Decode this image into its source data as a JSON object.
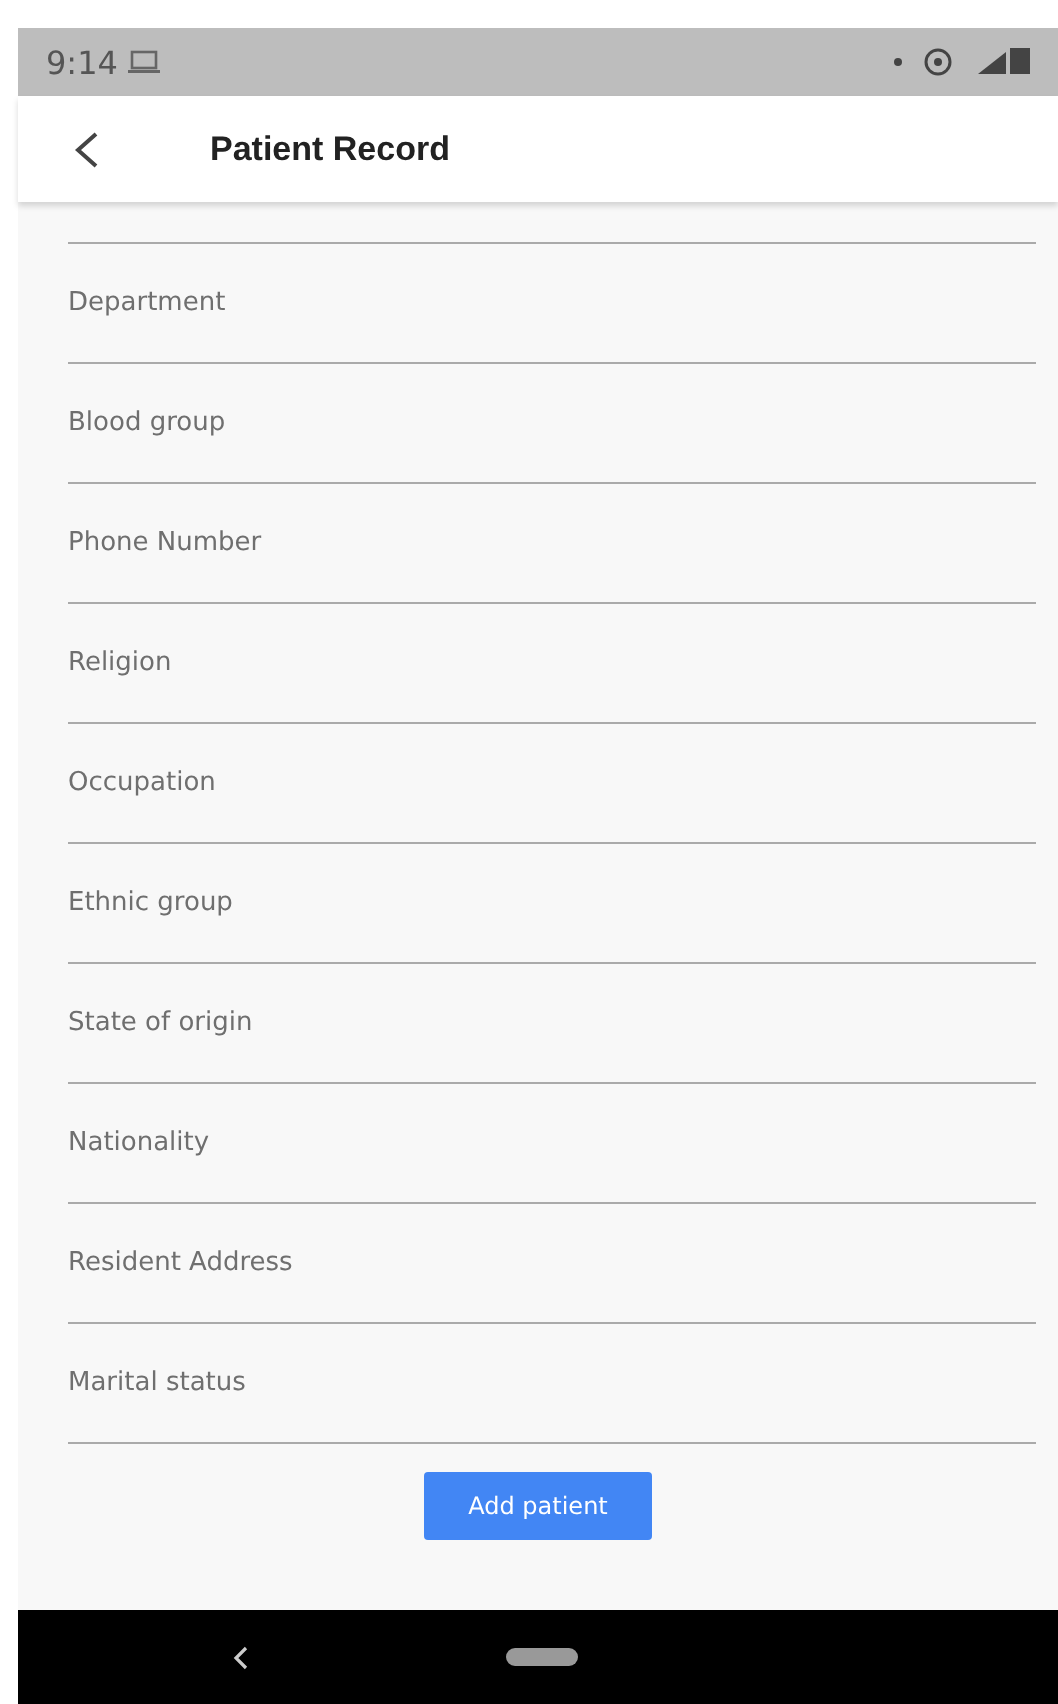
{
  "status_bar": {
    "time": "9:14"
  },
  "header": {
    "title": "Patient Record"
  },
  "fields": [
    {
      "placeholder": "Department"
    },
    {
      "placeholder": "Blood group"
    },
    {
      "placeholder": "Phone Number"
    },
    {
      "placeholder": "Religion"
    },
    {
      "placeholder": "Occupation"
    },
    {
      "placeholder": "Ethnic group"
    },
    {
      "placeholder": "State of origin"
    },
    {
      "placeholder": "Nationality"
    },
    {
      "placeholder": "Resident Address"
    },
    {
      "placeholder": "Marital status"
    }
  ],
  "button": {
    "label": "Add patient"
  }
}
